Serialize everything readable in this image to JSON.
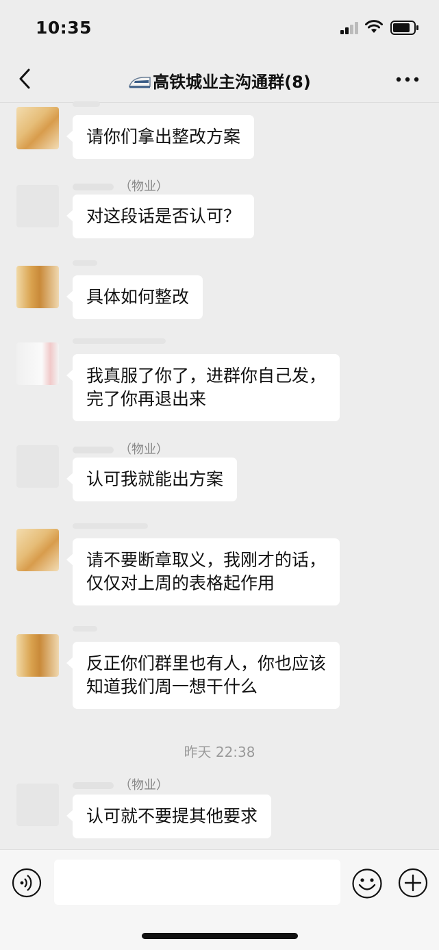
{
  "status_bar": {
    "time": "10:35"
  },
  "nav": {
    "title": "高铁城业主沟通群(8)"
  },
  "messages": [
    {
      "sender": "",
      "text_lines": [
        "请你们拿出整改方案"
      ]
    },
    {
      "sender": "（物业）",
      "text_lines": [
        "对这段话是否认可？"
      ]
    },
    {
      "sender": "",
      "text_lines": [
        "具体如何整改"
      ]
    },
    {
      "sender": "",
      "text_lines": [
        "我真服了你了，进群你自己发，",
        "完了你再退出来"
      ]
    },
    {
      "sender": "（物业）",
      "text_lines": [
        "认可我就能出方案"
      ]
    },
    {
      "sender": "",
      "text_lines": [
        "请不要断章取义，我刚才的话，",
        "仅仅对上周的表格起作用"
      ]
    },
    {
      "sender": "",
      "text_lines": [
        "反正你们群里也有人，你也应该",
        "知道我们周一想干什么"
      ]
    },
    {
      "sender": "（物业）",
      "text_lines": [
        "认可就不要提其他要求"
      ]
    }
  ],
  "timestamp": "昨天 22:38",
  "input": {
    "placeholder": ""
  },
  "icons": {
    "back": "chevron-left-icon",
    "train": "train-icon",
    "more": "more-icon",
    "voice": "voice-icon",
    "emoji": "emoji-icon",
    "plus": "plus-icon"
  }
}
